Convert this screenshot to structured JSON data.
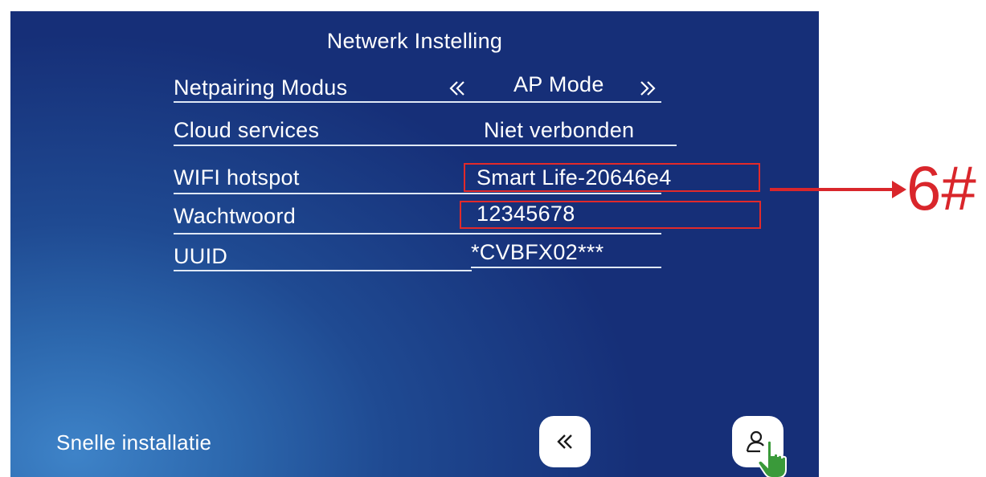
{
  "screen": {
    "title": "Netwerk Instelling",
    "rows": [
      {
        "label": "Netpairing Modus",
        "value": "AP Mode",
        "prev_icon": "chevron-double-left-icon",
        "next_icon": "chevron-double-right-icon"
      },
      {
        "label": "Cloud services",
        "value": "Niet verbonden"
      },
      {
        "label": "WIFI hotspot",
        "value": "Smart Life-20646e4"
      },
      {
        "label": "Wachtwoord",
        "value": "12345678"
      },
      {
        "label": "UUID",
        "value": "*CVBFX02***"
      }
    ],
    "footer": {
      "label": "Snelle installatie",
      "back_icon": "chevron-double-left-icon",
      "user_icon": "user-icon",
      "cursor_icon": "hand-pointer-icon"
    }
  },
  "annotation": {
    "text": "6#",
    "color": "#d9262b"
  },
  "colors": {
    "screen_bg": "#1f4a92",
    "highlight_box": "#e22a2a",
    "text": "#ffffff",
    "cursor_hand": "#3a9a3a"
  }
}
